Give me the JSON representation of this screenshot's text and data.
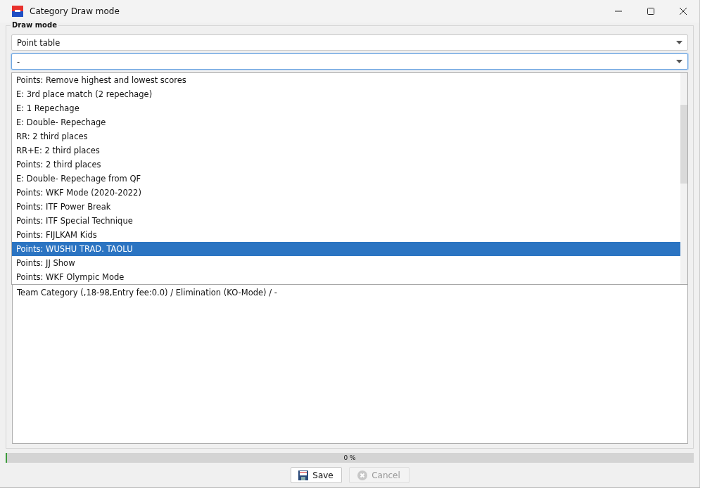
{
  "window": {
    "title": "Category Draw mode"
  },
  "group": {
    "label": "Draw mode"
  },
  "mode_combo": {
    "value": "Point table"
  },
  "sub_combo": {
    "value": "-",
    "expanded": true
  },
  "dropdown_items": [
    {
      "label": "Points: Remove highest and lowest scores",
      "selected": false
    },
    {
      "label": "E: 3rd place match (2 repechage)",
      "selected": false
    },
    {
      "label": "E: 1 Repechage",
      "selected": false
    },
    {
      "label": "E: Double- Repechage",
      "selected": false
    },
    {
      "label": "RR: 2 third places",
      "selected": false
    },
    {
      "label": "RR+E: 2 third places",
      "selected": false
    },
    {
      "label": "Points: 2 third places",
      "selected": false
    },
    {
      "label": "E: Double- Repechage from QF",
      "selected": false
    },
    {
      "label": "Points: WKF Mode (2020-2022)",
      "selected": false
    },
    {
      "label": "Points: ITF Power Break",
      "selected": false
    },
    {
      "label": "Points: ITF Special Technique",
      "selected": false
    },
    {
      "label": "Points: FIJLKAM Kids",
      "selected": false
    },
    {
      "label": "Points: WUSHU TRAD. TAOLU",
      "selected": true
    },
    {
      "label": "Points: JJ Show",
      "selected": false
    },
    {
      "label": "Points: WKF Olympic Mode",
      "selected": false
    }
  ],
  "summary": "Team Category (,18-98,Entry fee:0.0) / Elimination (KO-Mode) / -",
  "progress": {
    "label": "0 %",
    "level": 0
  },
  "buttons": [
    {
      "label": "Save",
      "kind": "save",
      "disabled": false
    },
    {
      "label": "Cancel",
      "kind": "cancel",
      "disabled": true
    }
  ]
}
